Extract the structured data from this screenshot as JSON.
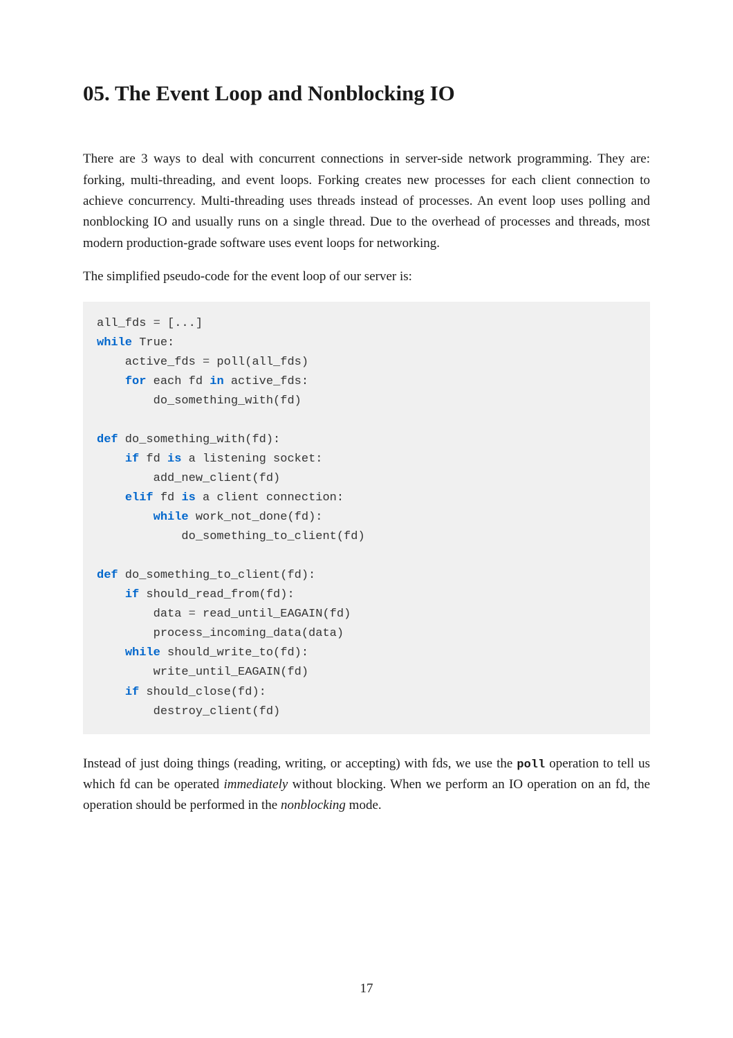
{
  "title": "05. The Event Loop and Nonblocking IO",
  "para1": "There are 3 ways to deal with concurrent connections in server-side network programming. They are: forking, multi-threading, and event loops. Forking creates new processes for each client connection to achieve concurrency. Multi-threading uses threads instead of processes. An event loop uses polling and nonblocking IO and usually runs on a single thread. Due to the overhead of processes and threads, most modern production-grade software uses event loops for networking.",
  "para2": "The simplified pseudo-code for the event loop of our server is:",
  "code": {
    "l1a": "all_fds ",
    "l1b": "=",
    "l1c": " [...]",
    "l2a": "while",
    "l2b": " True:",
    "l3a": "    active_fds ",
    "l3b": "=",
    "l3c": " poll(all_fds)",
    "l4a": "    ",
    "l4b": "for",
    "l4c": " each fd ",
    "l4d": "in",
    "l4e": " active_fds:",
    "l5": "        do_something_with(fd)",
    "l6a": "def",
    "l6b": " do_something_with(fd):",
    "l7a": "    ",
    "l7b": "if",
    "l7c": " fd ",
    "l7d": "is",
    "l7e": " a listening socket:",
    "l8": "        add_new_client(fd)",
    "l9a": "    ",
    "l9b": "elif",
    "l9c": " fd ",
    "l9d": "is",
    "l9e": " a client connection:",
    "l10a": "        ",
    "l10b": "while",
    "l10c": " work_not_done(fd):",
    "l11": "            do_something_to_client(fd)",
    "l12a": "def",
    "l12b": " do_something_to_client(fd):",
    "l13a": "    ",
    "l13b": "if",
    "l13c": " should_read_from(fd):",
    "l14a": "        data ",
    "l14b": "=",
    "l14c": " read_until_EAGAIN(fd)",
    "l15": "        process_incoming_data(data)",
    "l16a": "    ",
    "l16b": "while",
    "l16c": " should_write_to(fd):",
    "l17": "        write_until_EAGAIN(fd)",
    "l18a": "    ",
    "l18b": "if",
    "l18c": " should_close(fd):",
    "l19": "        destroy_client(fd)"
  },
  "para3_part1": "Instead of just doing things (reading, writing, or accepting) with fds, we use the ",
  "para3_code": "poll",
  "para3_part2": " operation to tell us which fd can be operated ",
  "para3_italic1": "immediately",
  "para3_part3": " without blocking. When we perform an IO operation on an fd, the operation should be performed in the ",
  "para3_italic2": "nonblocking",
  "para3_part4": " mode.",
  "page_number": "17"
}
